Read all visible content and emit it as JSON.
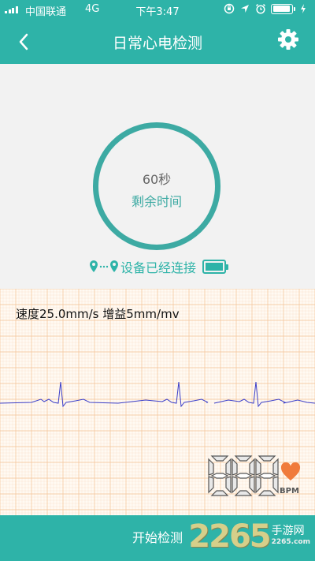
{
  "status_bar": {
    "carrier": "中国联通",
    "network": "4G",
    "time": "下午3:47",
    "battery_percent": 95
  },
  "nav": {
    "title": "日常心电检测",
    "back_icon": "chevron-left-icon",
    "settings_icon": "gear-icon"
  },
  "timer": {
    "seconds_text": "60秒",
    "label": "剩余时间"
  },
  "device": {
    "status_text": "设备已经连接",
    "battery_percent": 100
  },
  "ecg": {
    "speed_text": "速度25.0mm/s 增益5mm/mv",
    "grid_color": "#f5c9a0",
    "trace_color": "#3b3ec9"
  },
  "heart_rate": {
    "value": "000",
    "unit": "BPM",
    "heart_color": "#f07b3c"
  },
  "actions": {
    "start_label": "开始检测"
  },
  "watermark": {
    "number": "2265",
    "brand": "手游网",
    "site": "2265.com"
  },
  "colors": {
    "accent": "#2eb3a8",
    "ring": "#3daaa3"
  }
}
